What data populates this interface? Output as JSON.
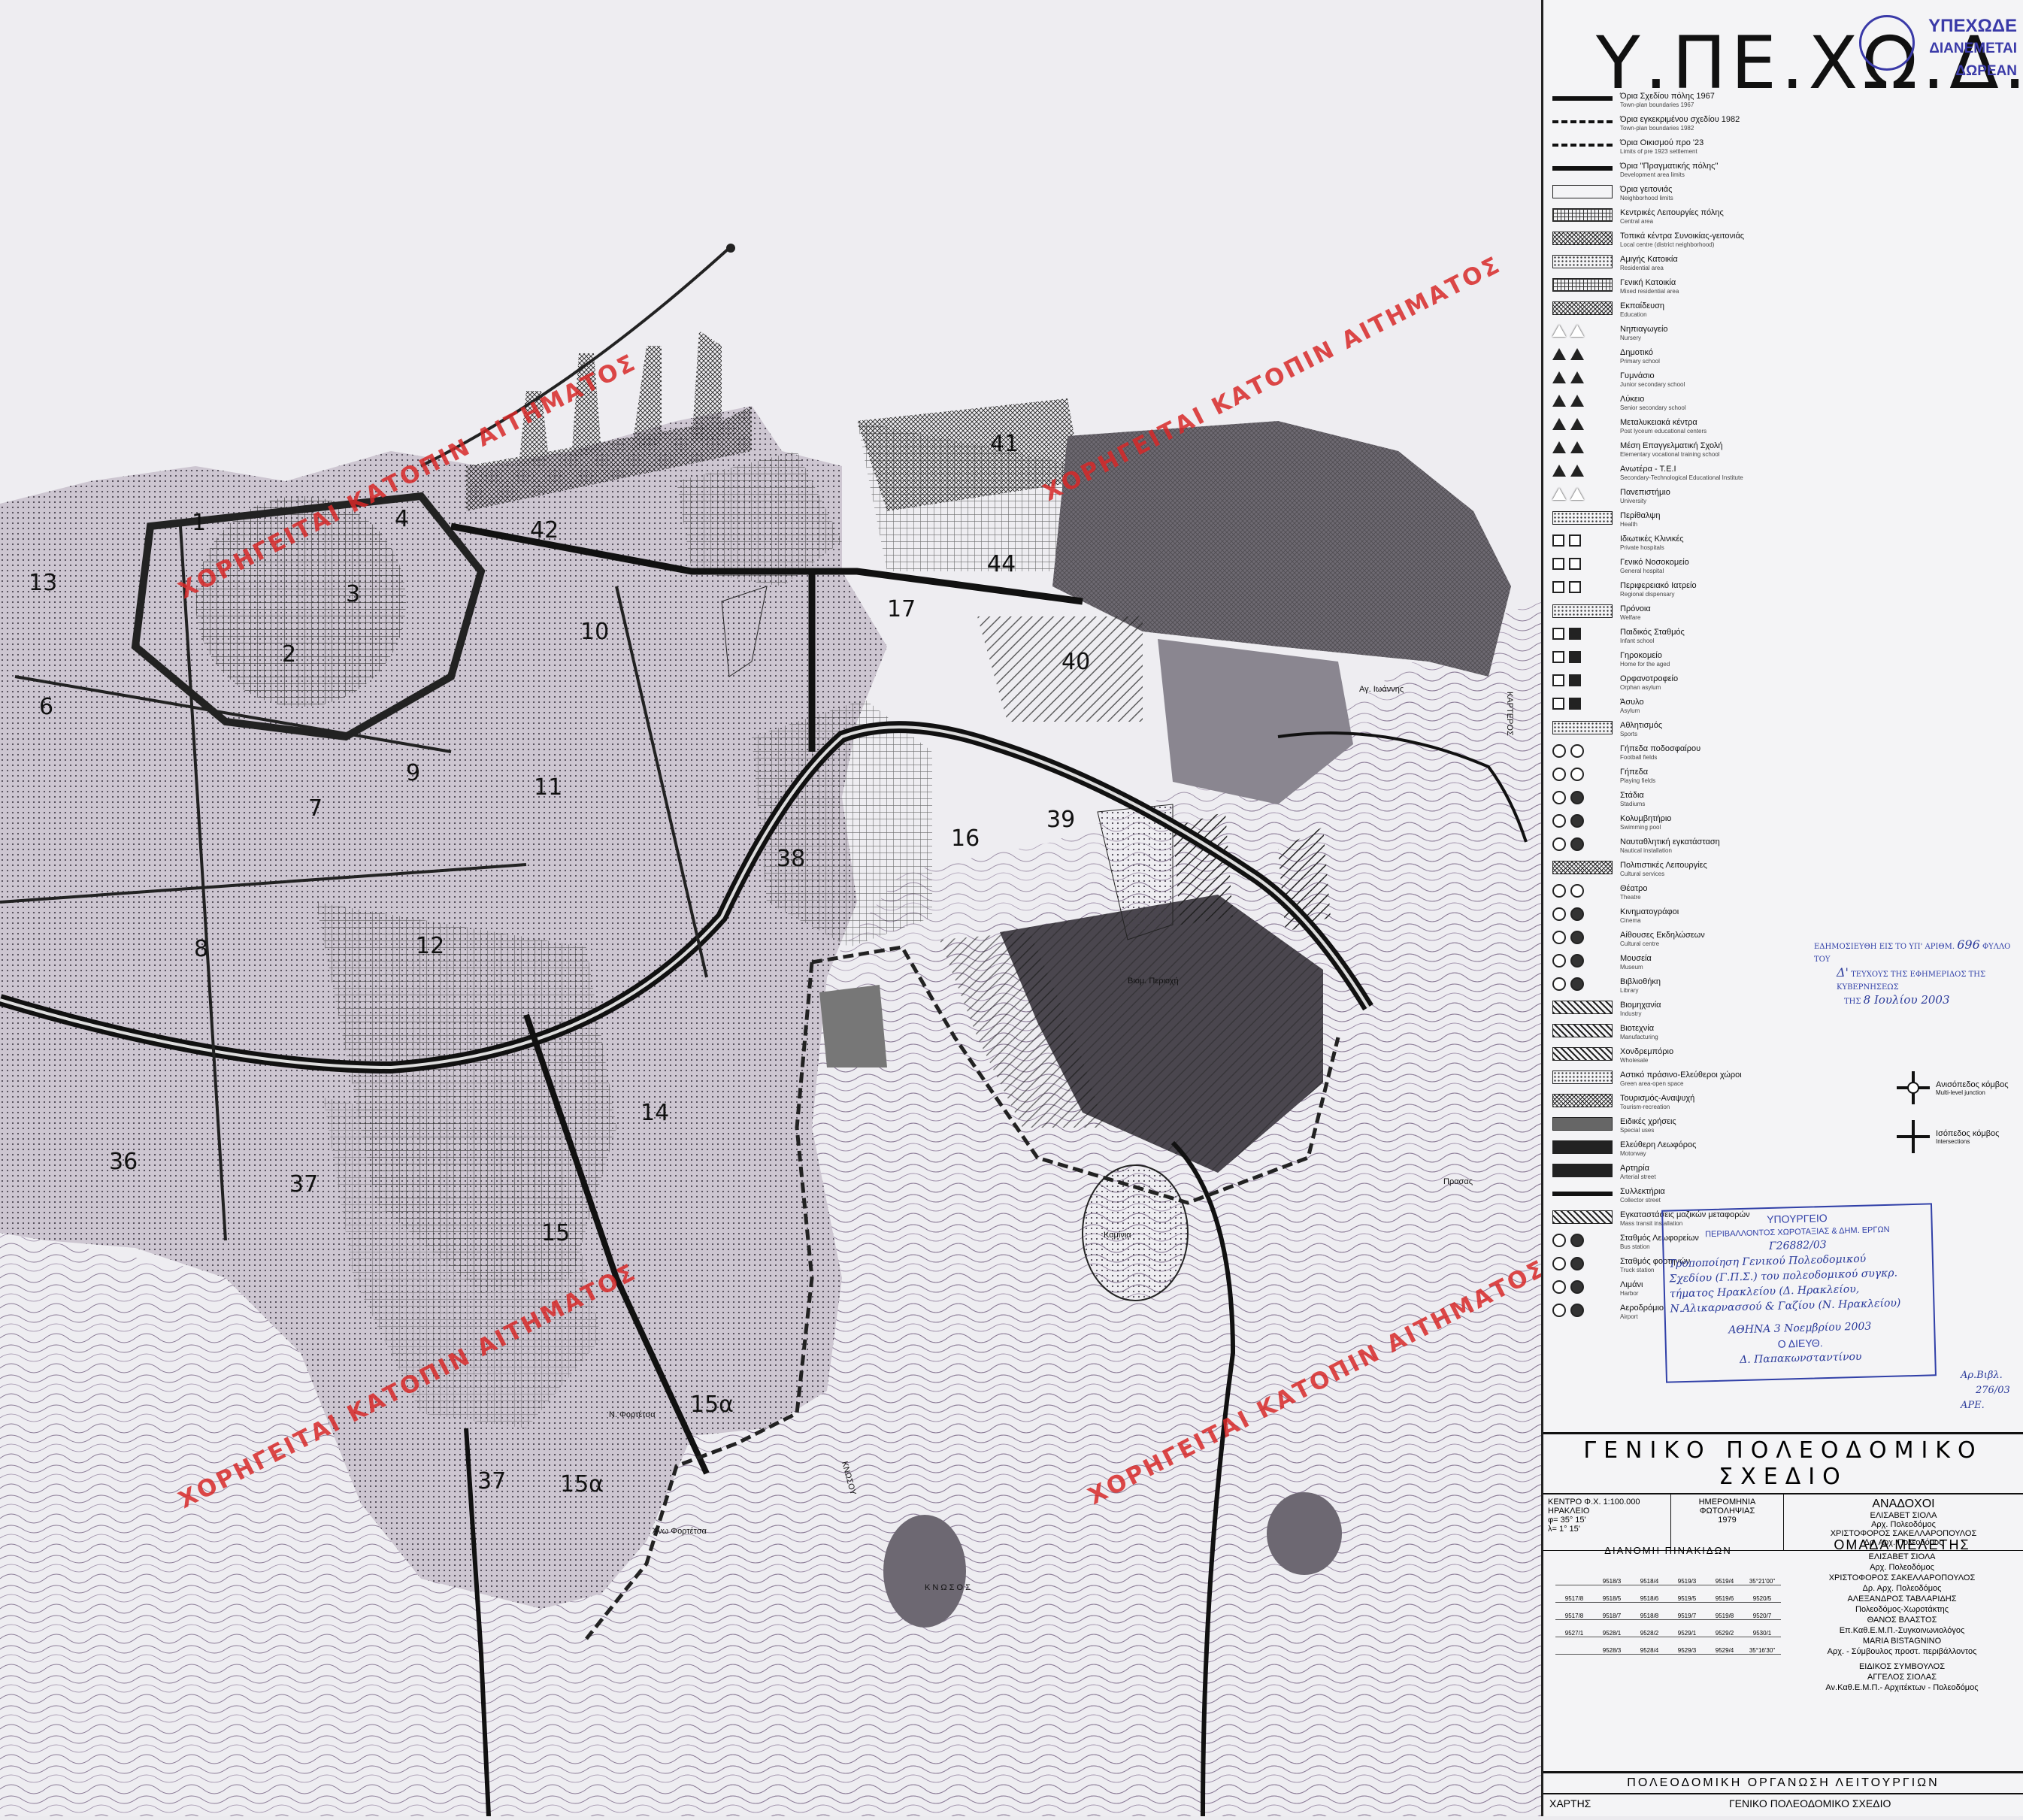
{
  "title": "Υ.ΠΕ.ΧΩ.Δ.Ε.",
  "logo": {
    "line1": "ΥΠΕΧΩΔΕ",
    "line2": "ΔΙΑΝΕΜΕΤΑΙ ΔΩΡΕΑΝ"
  },
  "watermark": "ΧΟΡΗΓΕΙΤΑΙ ΚΑΤΟΠΙΝ ΑΙΤΗΜΑΤΟΣ",
  "legend": {
    "items": [
      {
        "gr": "Όρια Σχεδίου πόλης 1967",
        "en": "Town-plan boundaries 1967",
        "sw": "line"
      },
      {
        "gr": "Όρια εγκεκριμένου σχεδίου 1982",
        "en": "Town-plan boundaries 1982",
        "sw": "dash"
      },
      {
        "gr": "Όρια Οικισμού προ '23",
        "en": "Limits of pre 1923 settlement",
        "sw": "dash"
      },
      {
        "gr": "Όρια \"Πραγματικής πόλης\"",
        "en": "Development area limits",
        "sw": "line"
      },
      {
        "gr": "Όρια γειτονιάς",
        "en": "Neighborhood limits",
        "sw": "box1"
      },
      {
        "gr": "Κεντρικές Λειτουργίες πόλης",
        "en": "Central area",
        "sw": "grid"
      },
      {
        "gr": "Τοπικά κέντρα Συνοικίας-γειτονιάς",
        "en": "Local centre (district neighborhood)",
        "sw": "hatchx"
      },
      {
        "gr": "Αμιγής Κατοικία",
        "en": "Residential area",
        "sw": "dots"
      },
      {
        "gr": "Γενική Κατοικία",
        "en": "Mixed residential area",
        "sw": "grid"
      },
      {
        "gr": "Εκπαίδευση",
        "en": "Education",
        "sw": "hatchx"
      },
      {
        "gr": "Νηπιαγωγείο",
        "en": "Nursery",
        "sw": "tri-o"
      },
      {
        "gr": "Δημοτικό",
        "en": "Primary school",
        "sw": "tri-f"
      },
      {
        "gr": "Γυμνάσιο",
        "en": "Junior secondary school",
        "sw": "tri-f"
      },
      {
        "gr": "Λύκειο",
        "en": "Senior secondary school",
        "sw": "tri-f"
      },
      {
        "gr": "Μεταλυκειακά κέντρα",
        "en": "Post lyceum educational centers",
        "sw": "tri-f"
      },
      {
        "gr": "Μέση Επαγγελματική Σχολή",
        "en": "Elementary vocational training school",
        "sw": "tri-f"
      },
      {
        "gr": "Ανωτέρα - Τ.Ε.Ι",
        "en": "Secondary-Technological Educational Institute",
        "sw": "tri-f"
      },
      {
        "gr": "Πανεπιστήμιο",
        "en": "University",
        "sw": "tri-o"
      },
      {
        "gr": "Περίθαλψη",
        "en": "Health",
        "sw": "dots"
      },
      {
        "gr": "Ιδιωτικές Κλινικές",
        "en": "Private hospitals",
        "sw": "sq"
      },
      {
        "gr": "Γενικό Νοσοκομείο",
        "en": "General hospital",
        "sw": "sq"
      },
      {
        "gr": "Περιφερειακό Ιατρείο",
        "en": "Regional dispensary",
        "sw": "sq"
      },
      {
        "gr": "Πρόνοια",
        "en": "Welfare",
        "sw": "dots"
      },
      {
        "gr": "Παιδικός Σταθμός",
        "en": "Infant school",
        "sw": "sq-f"
      },
      {
        "gr": "Γηροκομείο",
        "en": "Home for the aged",
        "sw": "sq-f"
      },
      {
        "gr": "Ορφανοτροφείο",
        "en": "Orphan asylum",
        "sw": "sq-f"
      },
      {
        "gr": "Άσυλο",
        "en": "Asylum",
        "sw": "sq-f"
      },
      {
        "gr": "Αθλητισμός",
        "en": "Sports",
        "sw": "dots"
      },
      {
        "gr": "Γήπεδα ποδοσφαίρου",
        "en": "Football fields",
        "sw": "circ"
      },
      {
        "gr": "Γήπεδα",
        "en": "Playing fields",
        "sw": "circ"
      },
      {
        "gr": "Στάδια",
        "en": "Stadiums",
        "sw": "circ-f"
      },
      {
        "gr": "Κολυμβητήριο",
        "en": "Swimming pool",
        "sw": "circ-f"
      },
      {
        "gr": "Ναυταθλητική εγκατάσταση",
        "en": "Nautical installation",
        "sw": "circ-f"
      },
      {
        "gr": "Πολιτιστικές Λειτουργίες",
        "en": "Cultural services",
        "sw": "hatchx"
      },
      {
        "gr": "Θέατρο",
        "en": "Theatre",
        "sw": "circ"
      },
      {
        "gr": "Κινηματογράφοι",
        "en": "Cinema",
        "sw": "circ-f"
      },
      {
        "gr": "Αίθουσες Εκδηλώσεων",
        "en": "Cultural centre",
        "sw": "circ-f"
      },
      {
        "gr": "Μουσεία",
        "en": "Museum",
        "sw": "circ-f"
      },
      {
        "gr": "Βιβλιοθήκη",
        "en": "Library",
        "sw": "circ-f"
      },
      {
        "gr": "Βιομηχανία",
        "en": "Industry",
        "sw": "hatchd"
      },
      {
        "gr": "Βιοτεχνία",
        "en": "Manufacturing",
        "sw": "hatchd"
      },
      {
        "gr": "Χονδρεμπόριο",
        "en": "Wholesale",
        "sw": "hatchd"
      },
      {
        "gr": "Αστικό πράσινο-Ελεύθεροι χώροι",
        "en": "Green area-open space",
        "sw": "dots"
      },
      {
        "gr": "Τουρισμός-Αναψυχή",
        "en": "Tourism-recreation",
        "sw": "hatchx"
      },
      {
        "gr": "Ειδικές χρήσεις",
        "en": "Special uses",
        "sw": "dark"
      },
      {
        "gr": "Ελεύθερη Λεωφόρος",
        "en": "Motorway",
        "sw": "solid"
      },
      {
        "gr": "Αρτηρία",
        "en": "Arterial street",
        "sw": "solid"
      },
      {
        "gr": "Συλλεκτήρια",
        "en": "Collector street",
        "sw": "line"
      },
      {
        "gr": "Εγκαταστάσεις μαζικών μεταφορών",
        "en": "Mass transit installation",
        "sw": "hatchd"
      },
      {
        "gr": "Σταθμός Λεωφορείων",
        "en": "Bus station",
        "sw": "circ-f"
      },
      {
        "gr": "Σταθμός φορτηγών",
        "en": "Truck station",
        "sw": "circ-f"
      },
      {
        "gr": "Λιμάνι",
        "en": "Harbor",
        "sw": "circ-f"
      },
      {
        "gr": "Αεροδρόμιο",
        "en": "Airport",
        "sw": "circ-f"
      }
    ],
    "junction_multi": {
      "gr": "Ανισόπεδος κόμβος",
      "en": "Multi-level junction"
    },
    "junction_level": {
      "gr": "Ισόπεδος κόμβος",
      "en": "Intersections"
    }
  },
  "publication_stamp": {
    "line1": "ΕΔΗΜΟΣΙΕΥΘΗ ΕΙΣ ΤΟ ΥΠ' ΑΡΙΘΜ.",
    "num": "696",
    "folio": "ΦΥΛΛΟ ΤΟΥ",
    "issue": "Δ'",
    "line2": "ΤΕΥΧΟΥΣ ΤΗΣ ΕΦΗΜΕΡΙΔΟΣ ΤΗΣ ΚΥΒΕΡΝΗΣΕΩΣ",
    "date_label": "ΤΗΣ",
    "date": "8 Ιουλίου 2003"
  },
  "ministry_stamp": {
    "l1": "ΥΠΟΥΡΓΕΙΟ",
    "l2": "ΠΕΡΙΒΑΛΛΟΝΤΟΣ ΧΩΡΟΤΑΞΙΑΣ & ΔΗΜ. ΕΡΓΩΝ",
    "l3": "Γ26882/03",
    "l4": "Τροποποίηση Γενικού Πολεοδομικού",
    "l5": "Σχεδίου (Γ.Π.Σ.) του πολεοδομικού συγκρ.",
    "l6": "τήματος Ηρακλείου (Δ. Ηρακλείου,",
    "l7": "Ν.Αλικαρνασσού & Γαζίου (Ν. Ηρακλείου)",
    "l8": "ΑΘΗΝΑ 3 Νοεμβρίου 2003",
    "l9": "Ο ΔΙΕΥΘ.",
    "sig": "Δ. Παπακωνσταντίνου"
  },
  "archive_note": {
    "l1": "Αρ.Βιβλ.",
    "l2": "276/03",
    "l3": "ΑΡΕ."
  },
  "titleblock": {
    "heading": "ΓΕΝΙΚΟ ΠΟΛΕΟΔΟΜΙΚΟ ΣΧΕΔΙΟ",
    "centre_label": "ΚΕΝΤΡΟ Φ.Χ. 1:100.000",
    "centre_name": "ΗΡΑΚΛΕΙΟ",
    "phi": "φ= 35° 15'",
    "lambda": "λ= 1° 15'",
    "photo_label": "ΗΜΕΡΟΜΗΝΙΑ ΦΩΤΟΛΗΨΙΑΣ",
    "photo_year": "1979",
    "contractors_label": "ΑΝΑΔΟΧΟΙ",
    "contractors": [
      "ΕΛΙΣΑΒΕΤ ΣΙΟΛΑ",
      "Αρχ. Πολεοδόμος",
      "ΧΡΙΣΤΟΦΟΡΟΣ ΣΑΚΕΛΛΑΡΟΠΟΥΛΟΣ",
      "Δρ. Αρχ. Πολεοδόμος"
    ],
    "team_label": "ΟΜΑΔΑ ΜΕΛΕΤΗΣ",
    "team": [
      "ΕΛΙΣΑΒΕΤ ΣΙΟΛΑ",
      "Αρχ. Πολεοδόμος",
      "ΧΡΙΣΤΟΦΟΡΟΣ ΣΑΚΕΛΛΑΡΟΠΟΥΛΟΣ",
      "Δρ. Αρχ. Πολεοδόμος",
      "ΑΛΕΞΑΝΔΡΟΣ ΤΑΒΛΑΡΙΔΗΣ",
      "Πολεοδόμος-Χωροτάκτης",
      "ΘΑΝΟΣ ΒΛΑΣΤΟΣ",
      "Επ.Καθ.Ε.Μ.Π.-Συγκοινωνιολόγος",
      "MARIA BISTAGNINO",
      "Αρχ. - Σύμβουλος προστ. περιβάλλοντος"
    ],
    "advisor_label": "ΕΙΔΙΚΟΣ ΣΥΜΒΟΥΛΟΣ",
    "advisor": [
      "ΑΓΓΕΛΟΣ ΣΙΟΛΑΣ",
      "Αν.Καθ.Ε.Μ.Π.- Αρχιτέκτων - Πολεοδόμος"
    ],
    "sheets_label": "ΔΙΑΝΟΜΗ ΠΙΝΑΚΙΔΩΝ",
    "sheets": [
      [
        "",
        "9518/3",
        "9518/4",
        "9519/3",
        "9519/4",
        "35°21'00\""
      ],
      [
        "9517/8",
        "9518/5",
        "9518/6",
        "9519/5",
        "9519/6",
        "9520/5"
      ],
      [
        "9517/8",
        "9518/7",
        "9518/8",
        "9519/7",
        "9519/8",
        "9520/7"
      ],
      [
        "9527/1",
        "9528/1",
        "9528/2",
        "9529/1",
        "9529/2",
        "9530/1"
      ],
      [
        "",
        "9528/3",
        "9528/4",
        "9529/3",
        "9529/4",
        "35°16'30\""
      ]
    ],
    "footer": "ΠΟΛΕΟΔΟΜΙΚΗ ΟΡΓΑΝΩΣΗ ΛΕΙΤΟΥΡΓΙΩΝ",
    "map_label": "ΧΑΡΤΗΣ",
    "footer2": "ΓΕΝΙΚΟ ΠΟΛΕΟΔΟΜΙΚΟ ΣΧΕΔΙΟ"
  },
  "map": {
    "neighborhoods": [
      "1",
      "2",
      "3",
      "4",
      "6",
      "7",
      "8",
      "9",
      "10",
      "11",
      "12",
      "13",
      "14",
      "15",
      "15α",
      "15α",
      "16",
      "17",
      "36",
      "37",
      "37",
      "38",
      "39",
      "40",
      "41",
      "42",
      "44"
    ],
    "places": [
      "Αγ. Ιωάννης",
      "ΚΑΡΤΕΡΟΣ",
      "ΚΝΩΣΟΥ",
      "Κ Ν Ω Σ Ο Σ",
      "Πρασας",
      "Άνω Φορτέτσα",
      "Ν. Φορτέτσα",
      "Καμίνια",
      "Βιομ. Περιοχή"
    ]
  }
}
